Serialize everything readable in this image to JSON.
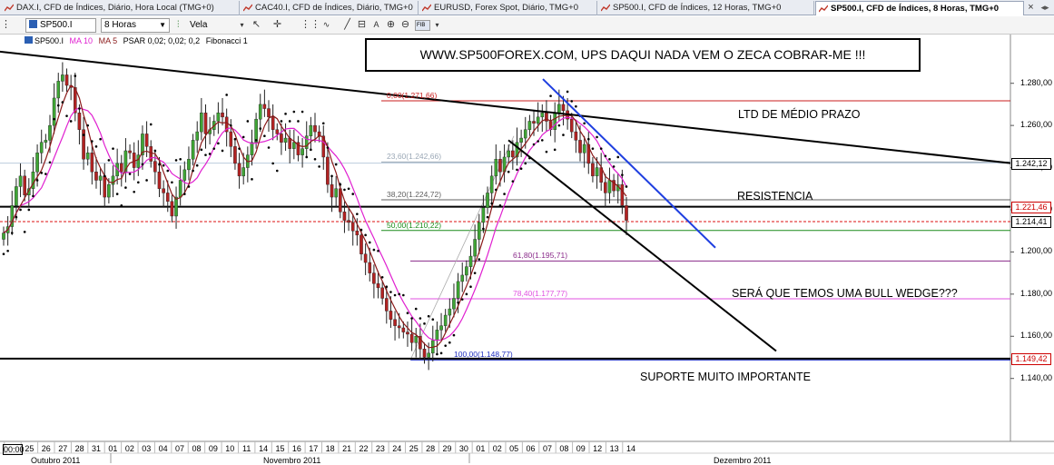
{
  "tabs": [
    {
      "label": "DAX.I, CFD de Índices, Diário, Hora Local (TMG+0)",
      "active": false
    },
    {
      "label": "CAC40.I, CFD de Índices, Diário, TMG+0",
      "active": false
    },
    {
      "label": "EURUSD, Forex Spot, Diário, TMG+0",
      "active": false
    },
    {
      "label": "SP500.I, CFD de Índices, 12 Horas, TMG+0",
      "active": false
    },
    {
      "label": "SP500.I, CFD de Índices, 8 Horas, TMG+0",
      "active": true
    }
  ],
  "tab_close": "×",
  "toolbar": {
    "symbol": "SP500.I",
    "timeframe": "8 Horas",
    "chart_style": "Vela",
    "fib_label": "FIB"
  },
  "indicators": {
    "symbol": "SP500.I",
    "ma10": "MA 10",
    "ma5": "MA 5",
    "psar": "PSAR 0,02; 0,02; 0,2",
    "fib": "Fibonacci 1"
  },
  "banner": "WWW.SP500FOREX.COM,  UPS DAQUI NADA VEM O ZECA  COBRAR-ME  !!!",
  "annotations": {
    "ltd": "LTD DE MÉDIO PRAZO",
    "resist": "RESISTENCIA",
    "wedge": "SERÁ QUE TEMOS UMA BULL WEDGE???",
    "support": "SUPORTE MUITO IMPORTANTE"
  },
  "colors": {
    "bull": "#3fa535",
    "bear": "#b22222",
    "ma10": "#e020d0",
    "ma5": "#8b1a1a",
    "psar": "#000000",
    "trend_blue": "#1f3fe0",
    "fib_0": "#c81e1e",
    "fib_236": "#9aa7b5",
    "fib_382": "#606060",
    "fib_50": "#1a8c1a",
    "fib_618": "#8a2a8a",
    "fib_786": "#e050e0",
    "fib_100": "#2030c0"
  },
  "chart_data": {
    "type": "candlestick",
    "y_axis": {
      "ticks": [
        "1.280,00",
        "1.260,00",
        "1.240,00",
        "1.220,00",
        "1.200,00",
        "1.180,00",
        "1.160,00",
        "1.140,00"
      ],
      "range": [
        1133,
        1295
      ]
    },
    "x_axis": {
      "days": [
        "00:00",
        "25",
        "26",
        "27",
        "28",
        "31",
        "01",
        "02",
        "03",
        "04",
        "07",
        "08",
        "09",
        "10",
        "11",
        "14",
        "15",
        "16",
        "17",
        "18",
        "21",
        "22",
        "23",
        "24",
        "25",
        "28",
        "29",
        "30",
        "01",
        "02",
        "05",
        "06",
        "07",
        "08",
        "09",
        "12",
        "13",
        "14"
      ],
      "months": [
        "Outubro 2011",
        "Novembro 2011",
        "Dezembro 2011"
      ]
    },
    "price_markers": [
      {
        "label": "1.242,12",
        "value": 1242.12,
        "style": "trendline"
      },
      {
        "label": "1.221,46",
        "value": 1221.46,
        "style": "red"
      },
      {
        "label": "1.214,41",
        "value": 1214.41,
        "style": "current"
      },
      {
        "label": "1.149,42",
        "value": 1149.42,
        "style": "red"
      }
    ],
    "fibonacci": [
      {
        "label": "0,00(1.271,66)",
        "value": 1271.66
      },
      {
        "label": "23,60(1.242,66)",
        "value": 1242.66
      },
      {
        "label": "38,20(1.224,72)",
        "value": 1224.72
      },
      {
        "label": "50,00(1.210,22)",
        "value": 1210.22
      },
      {
        "label": "61,80(1.195,71)",
        "value": 1195.71
      },
      {
        "label": "78,40(1.177,77)",
        "value": 1177.77
      },
      {
        "label": "100,00(1.148,77)",
        "value": 1148.77
      }
    ],
    "horizontal_lines": [
      {
        "name": "resistencia",
        "value": 1221.46
      },
      {
        "name": "suporte",
        "value": 1149.42
      }
    ],
    "close_series": [
      1209,
      1212,
      1222,
      1231,
      1236,
      1227,
      1230,
      1238,
      1247,
      1252,
      1253,
      1260,
      1273,
      1281,
      1284,
      1279,
      1278,
      1266,
      1258,
      1244,
      1247,
      1238,
      1234,
      1236,
      1226,
      1232,
      1236,
      1242,
      1238,
      1248,
      1247,
      1240,
      1246,
      1256,
      1250,
      1243,
      1238,
      1230,
      1228,
      1224,
      1217,
      1226,
      1234,
      1239,
      1244,
      1253,
      1257,
      1266,
      1256,
      1258,
      1262,
      1266,
      1264,
      1257,
      1250,
      1242,
      1236,
      1240,
      1246,
      1252,
      1263,
      1270,
      1268,
      1264,
      1258,
      1256,
      1252,
      1254,
      1249,
      1252,
      1246,
      1249,
      1255,
      1260,
      1257,
      1255,
      1245,
      1232,
      1226,
      1230,
      1219,
      1215,
      1214,
      1210,
      1208,
      1199,
      1195,
      1190,
      1185,
      1183,
      1178,
      1172,
      1168,
      1165,
      1164,
      1162,
      1161,
      1157,
      1160,
      1154,
      1150,
      1152,
      1158,
      1163,
      1165,
      1170,
      1173,
      1178,
      1186,
      1189,
      1193,
      1198,
      1206,
      1214,
      1221,
      1228,
      1236,
      1244,
      1238,
      1245,
      1248,
      1245,
      1252,
      1254,
      1258,
      1262,
      1261,
      1264,
      1266,
      1262,
      1258,
      1266,
      1270,
      1267,
      1263,
      1257,
      1253,
      1247,
      1251,
      1242,
      1236,
      1240,
      1233,
      1228,
      1234,
      1229,
      1232,
      1222,
      1215
    ]
  }
}
